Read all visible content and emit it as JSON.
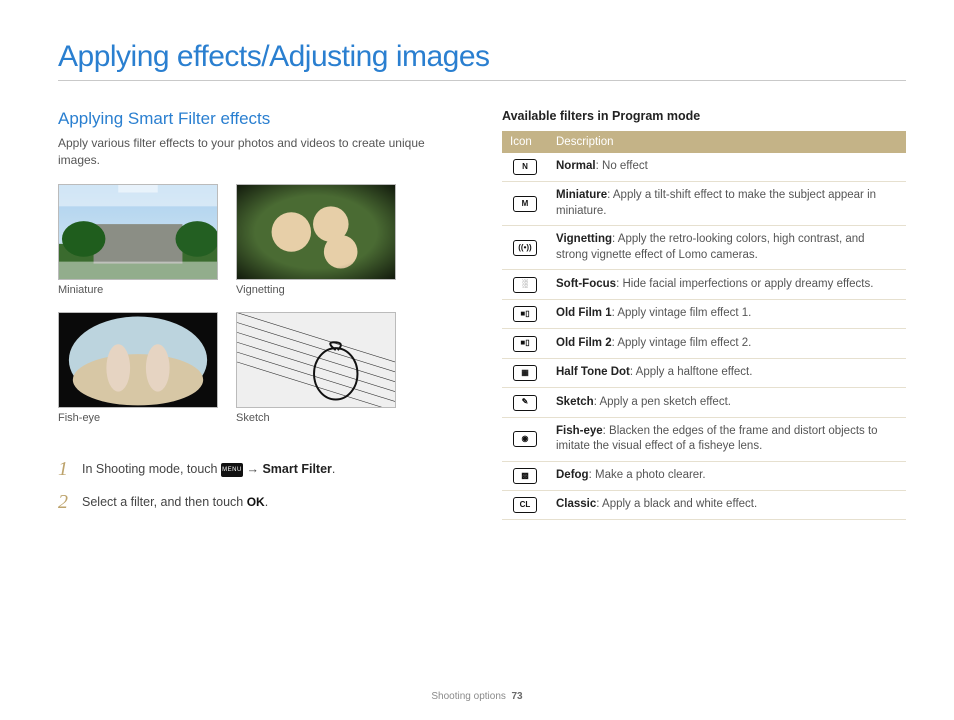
{
  "page_title": "Applying effects/Adjusting images",
  "left": {
    "subhead": "Applying Smart Filter effects",
    "intro": "Apply various filter effects to your photos and videos to create unique images.",
    "thumbs": [
      {
        "caption": "Miniature"
      },
      {
        "caption": "Vignetting"
      },
      {
        "caption": "Fish-eye"
      },
      {
        "caption": "Sketch"
      }
    ],
    "steps": {
      "one_a": "In Shooting mode, touch ",
      "one_b": " → ",
      "one_bold": "Smart Filter",
      "one_c": ".",
      "two_a": "Select a filter, and then touch ",
      "two_c": "."
    },
    "menu_label": "MENU",
    "ok_label": "OK"
  },
  "right": {
    "title": "Available filters in Program mode",
    "th_icon": "Icon",
    "th_desc": "Description",
    "rows": [
      {
        "icon": "N",
        "name": "Normal",
        "desc": ": No effect"
      },
      {
        "icon": "M",
        "name": "Miniature",
        "desc": ": Apply a tilt-shift effect to make the subject appear in miniature."
      },
      {
        "icon": "((•))",
        "name": "Vignetting",
        "desc": ": Apply the retro-looking colors, high contrast, and strong vignette effect of Lomo cameras."
      },
      {
        "icon": "░",
        "name": "Soft-Focus",
        "desc": ": Hide facial imperfections or apply dreamy effects."
      },
      {
        "icon": "■▯",
        "name": "Old Film 1",
        "desc": ": Apply vintage film effect 1."
      },
      {
        "icon": "■▯",
        "name": "Old Film 2",
        "desc": ": Apply vintage film effect 2."
      },
      {
        "icon": "▦",
        "name": "Half Tone Dot",
        "desc": ": Apply a halftone effect."
      },
      {
        "icon": "✎",
        "name": "Sketch",
        "desc": ": Apply a pen sketch effect."
      },
      {
        "icon": "◉",
        "name": "Fish-eye",
        "desc": ": Blacken the edges of the frame and distort objects to imitate the visual effect of a fisheye lens."
      },
      {
        "icon": "▩",
        "name": "Defog",
        "desc": ": Make a photo clearer."
      },
      {
        "icon": "CL",
        "name": "Classic",
        "desc": ": Apply a black and white effect."
      }
    ]
  },
  "footer": {
    "section": "Shooting options",
    "page": "73"
  }
}
